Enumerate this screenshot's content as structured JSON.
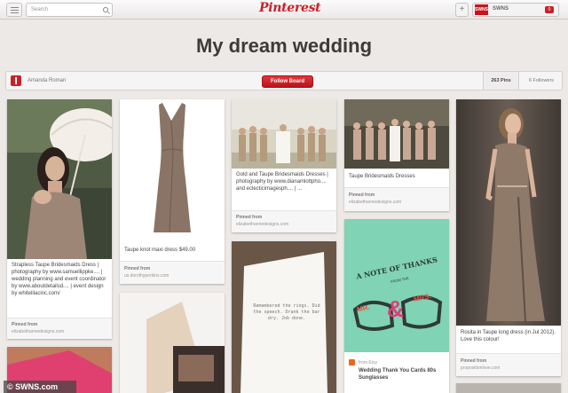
{
  "header": {
    "search_placeholder": "Search",
    "logo_text": "Pinterest",
    "add_label": "+",
    "user_badge": "SWNS",
    "user_name": "SWNS",
    "notification_count": "0"
  },
  "board": {
    "title": "My dream wedding",
    "owner": "Amanda Roman",
    "follow_label": "Follow Board",
    "pins": "263 Pins",
    "followers": "6 Followers"
  },
  "pins": [
    {
      "description": "Strapless Taupe Bridesmaids Dress | photography by www.samuellippke.... | wedding planning and event coordinator by www.aboutdetailsd.... | event design by whitelilacinc.com/",
      "pinned_from": "Pinned from",
      "source": "elizabethannedesigns.com"
    },
    {
      "description": "Taupe knot maxi dress $49.00",
      "pinned_from": "Pinned from",
      "source": "us.dorothyperkins.com"
    },
    {
      "description": "Gold and Taupe Bridesmaids Dresses | photography by www.dianamlottpho.... and eclecticimagesph.... | ...",
      "pinned_from": "Pinned from",
      "source": "elizabethannedesigns.com"
    },
    {
      "description": "Taupe Bridesmaids Dresses",
      "pinned_from": "Pinned from",
      "source": "elizabethannedesigns.com"
    },
    {
      "description": "Rosita in Taupe long dress (in Jul 2012). Love this colour!",
      "pinned_from": "Pinned from",
      "source": "propositionlove.com"
    },
    {
      "card_text": "Remembered the rings. Did the speech. Drank the bar dry. Job done."
    },
    {
      "card_title": "A NOTE OF THANKS",
      "card_subtitle": "FROM THE",
      "card_mr": "MR.",
      "card_amp": "&",
      "card_mrs": "MRS.",
      "store": "from Etsy",
      "description": "Wedding Thank You Cards 80s Sunglasses"
    }
  ],
  "watermark": "© SWNS.com",
  "colors": {
    "brand_red": "#cb2027",
    "background": "#ece9e7",
    "mint": "#7fd3b2",
    "taupe": "#8a7466"
  }
}
